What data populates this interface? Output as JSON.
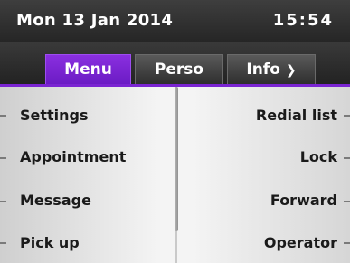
{
  "status": {
    "date": "Mon 13 Jan 2014",
    "time": "15:54"
  },
  "tabs": [
    {
      "label": "Menu",
      "active": true
    },
    {
      "label": "Perso",
      "active": false
    },
    {
      "label": "Info",
      "active": false
    }
  ],
  "exit_icon": "exit-arrow-icon",
  "menu": {
    "left": [
      "Settings",
      "Appointment",
      "Message",
      "Pick up"
    ],
    "right": [
      "Redial list",
      "Lock",
      "Forward",
      "Operator"
    ]
  },
  "colors": {
    "accent": "#7a24d2",
    "panel": "#f0f0f0"
  }
}
